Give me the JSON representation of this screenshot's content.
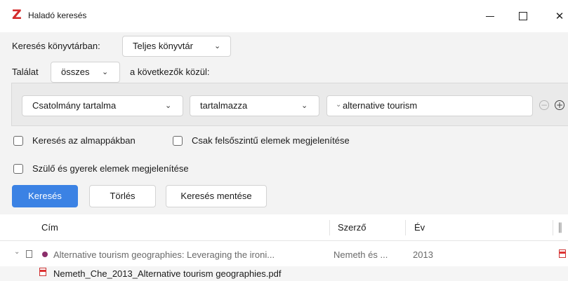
{
  "window": {
    "title": "Haladó keresés",
    "logo": "Z",
    "controls": {
      "minimize": "minimize-icon",
      "maximize": "maximize-icon",
      "close": "✕"
    }
  },
  "search": {
    "in_library_label": "Keresés könyvtárban:",
    "library_value": "Teljes könyvtár",
    "match_label": "Találat",
    "match_value": "összes",
    "match_suffix": "a következők közül:",
    "condition": {
      "field": "Csatolmány tartalma",
      "operator": "tartalmazza",
      "value": "alternative tourism",
      "mode_icon": "chevron-down-icon"
    },
    "options": [
      {
        "label": "Keresés az almappákban",
        "checked": false
      },
      {
        "label": "Csak felsőszintű elemek megjelenítése",
        "checked": false
      },
      {
        "label": "Szülő és gyerek elemek megjelenítése",
        "checked": false
      }
    ],
    "buttons": {
      "search": "Keresés",
      "clear": "Törlés",
      "save": "Keresés mentése"
    }
  },
  "results": {
    "columns": {
      "title": "Cím",
      "author": "Szerző",
      "year": "Év",
      "attachment_icon": "paperclip-icon"
    },
    "rows": [
      {
        "title": "Alternative tourism geographies: Leveraging the ironi...",
        "author": "Nemeth és ...",
        "year": "2013",
        "type_icon": "document-icon",
        "tag_color": "#8b2e6b",
        "attachment_icon": "pdf-icon"
      },
      {
        "title": "Nemeth_Che_2013_Alternative tourism geographies.pdf",
        "type_icon": "pdf-icon"
      }
    ]
  },
  "colors": {
    "accent": "#3b82e4",
    "logo": "#d42c2c",
    "tag": "#8b2e6b"
  }
}
